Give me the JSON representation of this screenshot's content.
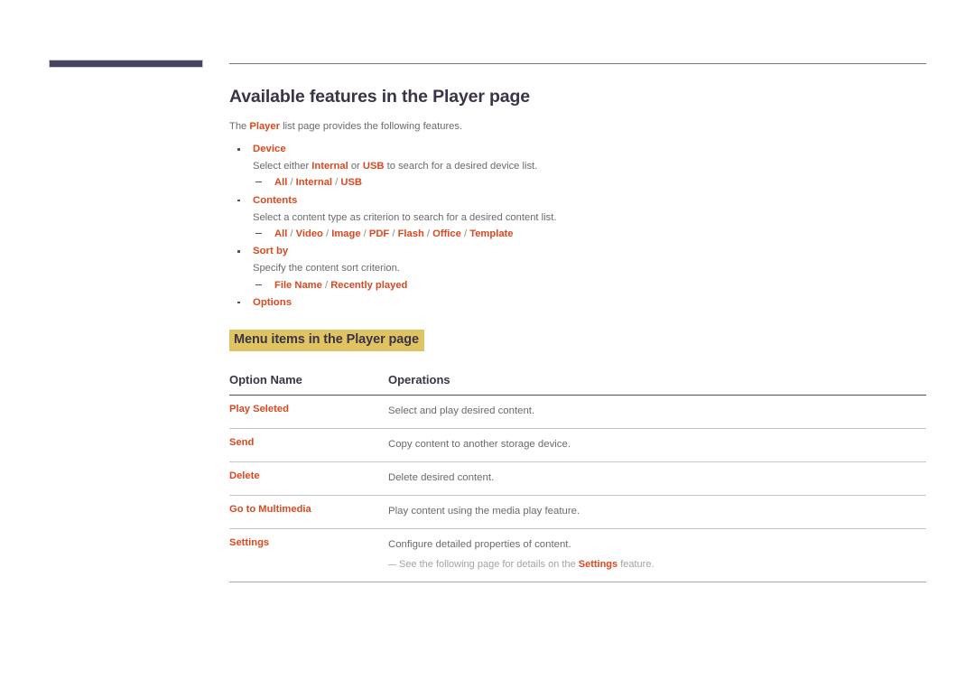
{
  "page": {
    "title": "Available features in the Player page",
    "intro": {
      "before": "The ",
      "highlight": "Player",
      "after": " list page provides the following features."
    }
  },
  "colors": {
    "accent_orange": "#d9491f",
    "heading_slate": "#3b3448",
    "highlight_gold": "#e0c463",
    "tab_marker": "#454560",
    "body_gray": "#6a6a6c",
    "note_gray": "#a3a3a5",
    "rule_gray": "#77777a"
  },
  "features": [
    {
      "name": "Device",
      "description_parts": [
        {
          "text": "Select either ",
          "style": "normal"
        },
        {
          "text": "Internal",
          "style": "bold-orange"
        },
        {
          "text": " or ",
          "style": "normal"
        },
        {
          "text": "USB",
          "style": "bold-orange"
        },
        {
          "text": " to search for a desired device list.",
          "style": "normal"
        }
      ],
      "options": [
        "All",
        "Internal",
        "USB"
      ]
    },
    {
      "name": "Contents",
      "description_parts": [
        {
          "text": "Select a content type as criterion to search for a desired content list.",
          "style": "normal"
        }
      ],
      "options": [
        "All",
        "Video",
        "Image",
        "PDF",
        "Flash",
        "Office",
        "Template"
      ]
    },
    {
      "name": "Sort by",
      "description_parts": [
        {
          "text": "Specify the content sort criterion.",
          "style": "normal"
        }
      ],
      "options": [
        "File Name",
        "Recently played"
      ]
    },
    {
      "name": "Options",
      "description_parts": [],
      "options": []
    }
  ],
  "menu_section": {
    "heading": "Menu items in the Player page",
    "table": {
      "columns": [
        "Option Name",
        "Operations"
      ],
      "rows": [
        {
          "option": "Play Seleted",
          "operation": "Select and play desired content.",
          "note": null
        },
        {
          "option": "Send",
          "operation": "Copy content to another storage device.",
          "note": null
        },
        {
          "option": "Delete",
          "operation": "Delete desired content.",
          "note": null
        },
        {
          "option": "Go to Multimedia",
          "operation": "Play content using the media play feature.",
          "note": null
        },
        {
          "option": "Settings",
          "operation": "Configure detailed properties of content.",
          "note": {
            "before": "See the following page for details on the ",
            "highlight": "Settings",
            "after": " feature."
          }
        }
      ]
    }
  }
}
